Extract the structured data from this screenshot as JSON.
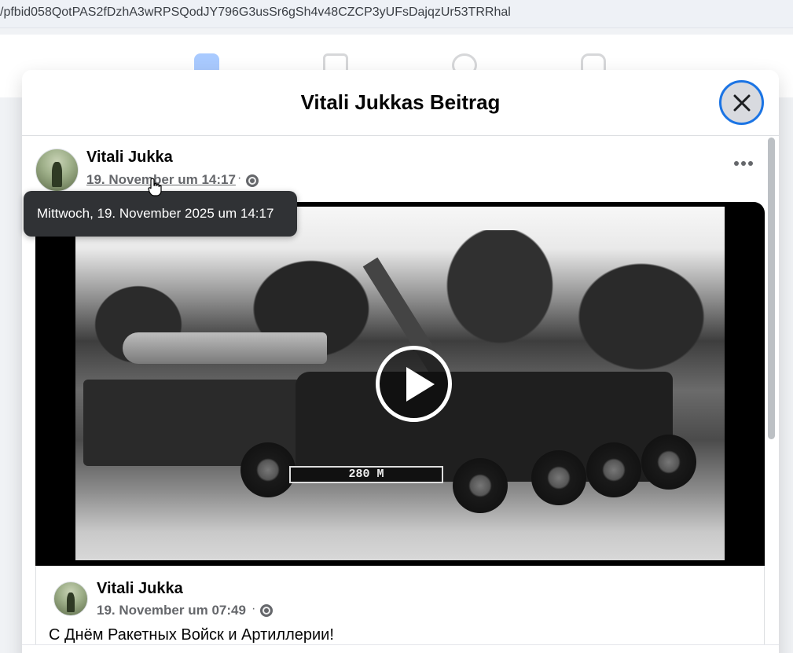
{
  "browser": {
    "url": "/pfbid058QotPAS2fDzhA3wRPSQodJY796G3usSr6gSh4v48CZCP3yUFsDajqzUr53TRRhal"
  },
  "nav": {
    "icons": [
      "home-icon",
      "marketplace-icon",
      "groups-icon",
      "gaming-icon"
    ]
  },
  "dialog": {
    "title": "Vitali Jukkas Beitrag",
    "close_icon": "close-icon"
  },
  "post": {
    "author": "Vitali Jukka",
    "timestamp": "19. November um 14:17",
    "separator": "·",
    "privacy_icon": "globe-icon",
    "more_icon": "more-options-icon",
    "tooltip": "Mittwoch, 19. November 2025 um 14:17"
  },
  "video": {
    "plate_text": "280 M",
    "play_icon": "play-icon"
  },
  "shared_post": {
    "author": "Vitali Jukka",
    "timestamp": "19. November um 07:49",
    "separator": "·",
    "privacy_icon": "globe-icon",
    "message": "С Днём Ракетных Войск и Артиллерии!"
  },
  "colors": {
    "accent": "#1b74e4",
    "secondary_text": "#65676b",
    "tooltip_bg": "#303235"
  }
}
